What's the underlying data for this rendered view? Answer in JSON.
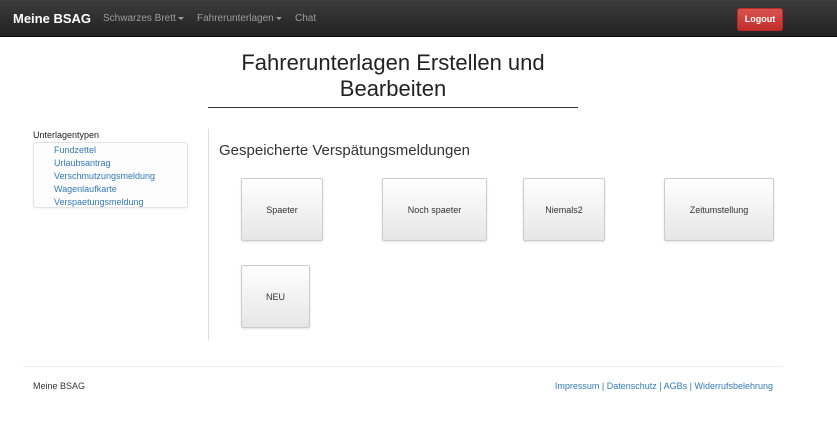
{
  "navbar": {
    "brand": "Meine BSAG",
    "items": [
      {
        "label": "Schwarzes Brett",
        "has_caret": true
      },
      {
        "label": "Fahrerunterlagen",
        "has_caret": true
      },
      {
        "label": "Chat",
        "has_caret": false
      }
    ],
    "logout_label": "Logout"
  },
  "page": {
    "title_line1": "Fahrerunterlagen Erstellen und",
    "title_line2": "Bearbeiten"
  },
  "sidebar": {
    "label": "Unterlagentypen",
    "items": [
      "Fundzettel",
      "Urlaubsantrag",
      "Verschmutzungsmeldung",
      "Wagenlaufkarte",
      "Verspaetungsmeldung"
    ]
  },
  "main": {
    "heading": "Gespeicherte Verspätungsmeldungen",
    "cards": [
      "Spaeter",
      "Noch spaeter",
      "Niemals2",
      "Zeitumstellung",
      "NEU"
    ]
  },
  "footer": {
    "brand": "Meine BSAG",
    "links": [
      "Impressum",
      "Datenschutz",
      "AGBs",
      "Widerrufsbelehrung"
    ],
    "separator": " | "
  },
  "colors": {
    "navbar_bg": "#222222",
    "link": "#337ab7",
    "logout": "#d9534f"
  },
  "icons": [
    "caret-down-icon"
  ]
}
